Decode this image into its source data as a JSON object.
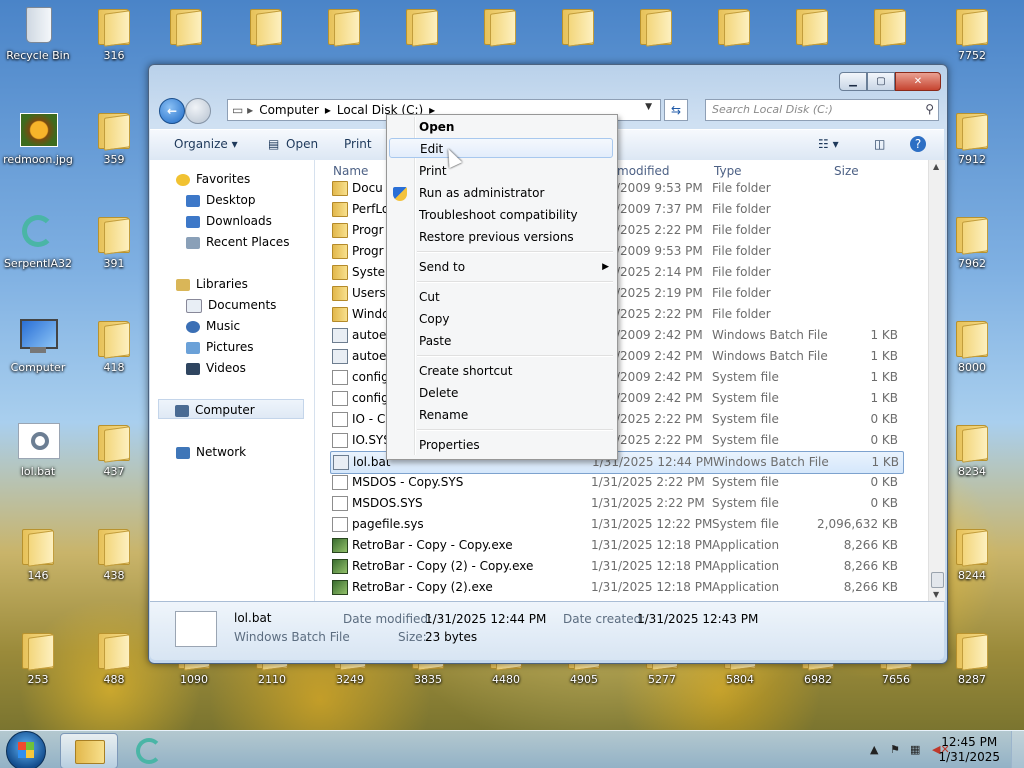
{
  "desktop": {
    "icons": [
      {
        "label": "Recycle Bin",
        "type": "recycle",
        "pos": "c0r0"
      },
      {
        "label": "316",
        "type": "folder"
      },
      {
        "label": "redmoon.jpg",
        "type": "image"
      },
      {
        "label": "359",
        "type": "folder"
      },
      {
        "label": "SerpentIA32",
        "type": "app"
      },
      {
        "label": "391",
        "type": "folder"
      },
      {
        "label": "Computer",
        "type": "computer"
      },
      {
        "label": "418",
        "type": "folder"
      },
      {
        "label": "lol.bat",
        "type": "bat"
      },
      {
        "label": "437",
        "type": "folder"
      },
      {
        "label": "146",
        "type": "folder"
      },
      {
        "label": "438",
        "type": "folder"
      },
      {
        "label": "253",
        "type": "folder"
      },
      {
        "label": "488",
        "type": "folder"
      },
      {
        "label": "1090",
        "type": "folder"
      },
      {
        "label": "2110",
        "type": "folder"
      },
      {
        "label": "3249",
        "type": "folder"
      },
      {
        "label": "3835",
        "type": "folder"
      },
      {
        "label": "4480",
        "type": "folder"
      },
      {
        "label": "4905",
        "type": "folder"
      },
      {
        "label": "5277",
        "type": "folder"
      },
      {
        "label": "5804",
        "type": "folder"
      },
      {
        "label": "6982",
        "type": "folder"
      },
      {
        "label": "7656",
        "type": "folder"
      },
      {
        "label": "8287",
        "type": "folder"
      },
      {
        "label": "7752",
        "type": "folder"
      },
      {
        "label": "7912",
        "type": "folder"
      },
      {
        "label": "7962",
        "type": "folder"
      },
      {
        "label": "8000",
        "type": "folder"
      },
      {
        "label": "8234",
        "type": "folder"
      },
      {
        "label": "8244",
        "type": "folder"
      }
    ]
  },
  "explorer": {
    "address": [
      "Computer",
      "Local Disk (C:)"
    ],
    "search_placeholder": "Search Local Disk (C:)",
    "toolbar": {
      "organize": "Organize ▾",
      "open": "Open",
      "print": "Print"
    },
    "nav": {
      "favorites": "Favorites",
      "desktop": "Desktop",
      "downloads": "Downloads",
      "recent": "Recent Places",
      "libraries": "Libraries",
      "documents": "Documents",
      "music": "Music",
      "pictures": "Pictures",
      "videos": "Videos",
      "computer": "Computer",
      "network": "Network"
    },
    "columns": {
      "name": "Name",
      "modified": "modified",
      "type": "Type",
      "size": "Size"
    },
    "files": [
      {
        "name": "Docu",
        "date": "/2009 9:53 PM",
        "type": "File folder",
        "size": "",
        "icon": "folder"
      },
      {
        "name": "PerfLo",
        "date": "/2009 7:37 PM",
        "type": "File folder",
        "size": "",
        "icon": "folder"
      },
      {
        "name": "Progr",
        "date": "/2025 2:22 PM",
        "type": "File folder",
        "size": "",
        "icon": "folder"
      },
      {
        "name": "Progr",
        "date": "/2009 9:53 PM",
        "type": "File folder",
        "size": "",
        "icon": "folder"
      },
      {
        "name": "Syster",
        "date": "/2025 2:14 PM",
        "type": "File folder",
        "size": "",
        "icon": "folder"
      },
      {
        "name": "Users",
        "date": "/2025 2:19 PM",
        "type": "File folder",
        "size": "",
        "icon": "folder"
      },
      {
        "name": "Windo",
        "date": "/2025 2:22 PM",
        "type": "File folder",
        "size": "",
        "icon": "folder"
      },
      {
        "name": "autoe",
        "date": "/2009 2:42 PM",
        "type": "Windows Batch File",
        "size": "1 KB",
        "icon": "bat"
      },
      {
        "name": "autoe",
        "date": "/2009 2:42 PM",
        "type": "Windows Batch File",
        "size": "1 KB",
        "icon": "bat"
      },
      {
        "name": "config",
        "date": "/2009 2:42 PM",
        "type": "System file",
        "size": "1 KB",
        "icon": "doc"
      },
      {
        "name": "config",
        "date": "/2009 2:42 PM",
        "type": "System file",
        "size": "1 KB",
        "icon": "doc"
      },
      {
        "name": "IO - C",
        "date": "/2025 2:22 PM",
        "type": "System file",
        "size": "0 KB",
        "icon": "doc"
      },
      {
        "name": "IO.SYS",
        "date": "/2025 2:22 PM",
        "type": "System file",
        "size": "0 KB",
        "icon": "doc"
      },
      {
        "name": "lol.bat",
        "date": "1/31/2025 12:44 PM",
        "type": "Windows Batch File",
        "size": "1 KB",
        "icon": "bat",
        "selected": true
      },
      {
        "name": "MSDOS - Copy.SYS",
        "date": "1/31/2025 2:22 PM",
        "type": "System file",
        "size": "0 KB",
        "icon": "doc"
      },
      {
        "name": "MSDOS.SYS",
        "date": "1/31/2025 2:22 PM",
        "type": "System file",
        "size": "0 KB",
        "icon": "doc"
      },
      {
        "name": "pagefile.sys",
        "date": "1/31/2025 12:22 PM",
        "type": "System file",
        "size": "2,096,632 KB",
        "icon": "doc"
      },
      {
        "name": "RetroBar - Copy - Copy.exe",
        "date": "1/31/2025 12:18 PM",
        "type": "Application",
        "size": "8,266 KB",
        "icon": "exe"
      },
      {
        "name": "RetroBar - Copy (2) - Copy.exe",
        "date": "1/31/2025 12:18 PM",
        "type": "Application",
        "size": "8,266 KB",
        "icon": "exe"
      },
      {
        "name": "RetroBar - Copy (2).exe",
        "date": "1/31/2025 12:18 PM",
        "type": "Application",
        "size": "8,266 KB",
        "icon": "exe"
      }
    ],
    "details": {
      "name": "lol.bat",
      "type": "Windows Batch File",
      "modified_label": "Date modified:",
      "modified": "1/31/2025 12:44 PM",
      "created_label": "Date created:",
      "created": "1/31/2025 12:43 PM",
      "size_label": "Size:",
      "size": "23 bytes"
    }
  },
  "context_menu": {
    "open": "Open",
    "edit": "Edit",
    "print": "Print",
    "run_admin": "Run as administrator",
    "troubleshoot": "Troubleshoot compatibility",
    "restore": "Restore previous versions",
    "send_to": "Send to",
    "cut": "Cut",
    "copy": "Copy",
    "paste": "Paste",
    "create_shortcut": "Create shortcut",
    "delete": "Delete",
    "rename": "Rename",
    "properties": "Properties"
  },
  "taskbar": {
    "time": "12:45 PM",
    "date": "1/31/2025"
  }
}
